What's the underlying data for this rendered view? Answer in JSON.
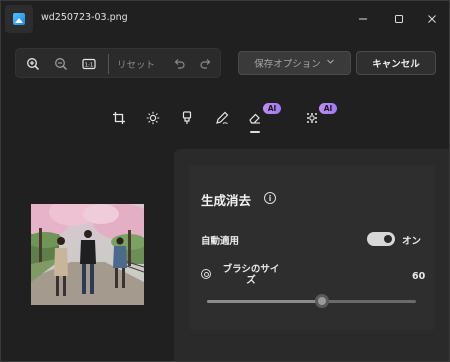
{
  "window": {
    "title": "wd250723-03.png",
    "icons": {
      "app": "photos-app-icon",
      "minimize": "minimize-icon",
      "maximize": "maximize-icon",
      "close": "close-icon"
    }
  },
  "toolbar": {
    "icons": [
      "zoom-in-icon",
      "zoom-out-icon",
      "actual-size-icon",
      "undo-icon",
      "redo-icon"
    ],
    "reset_label": "リセット",
    "save_options_label": "保存オプション",
    "cancel_label": "キャンセル"
  },
  "edit_tools": {
    "icons": [
      "crop-icon",
      "brightness-icon",
      "filter-icon",
      "markup-icon",
      "erase-icon",
      "background-blur-icon"
    ],
    "erase_badge": "AI",
    "background_badge": "AI",
    "active": "erase-icon"
  },
  "panel": {
    "title": "生成消去",
    "auto_apply_label": "自動適用",
    "auto_apply_state": "オン",
    "brush_size_label": "ブラシのサイズ",
    "brush_size_value": "60",
    "slider_fraction": 0.55
  },
  "colors": {
    "ai_badge": "#b48af2",
    "toggle_on": "#d8d8d8",
    "panel_bg": "#2e2e2e"
  }
}
